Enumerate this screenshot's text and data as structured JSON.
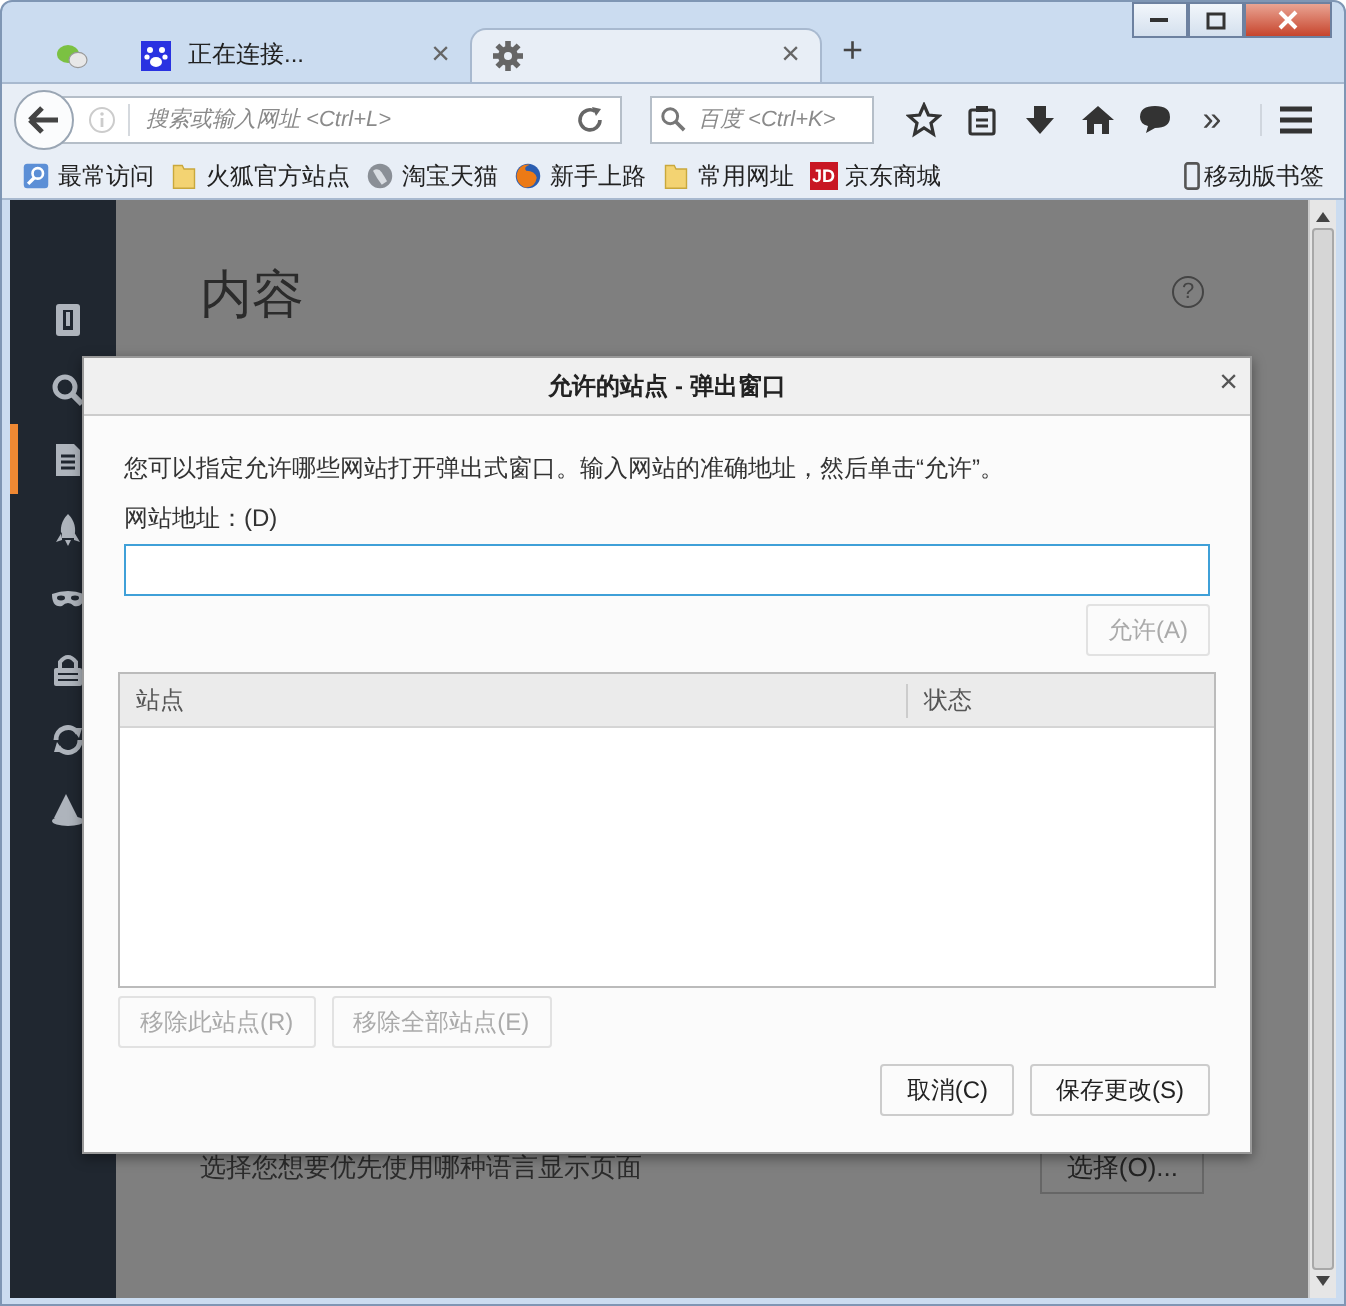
{
  "tabs": [
    {
      "kind": "chat",
      "selected": false
    },
    {
      "kind": "paw",
      "label": "正在连接...",
      "close": "×",
      "selected": false
    },
    {
      "kind": "gear",
      "close": "×",
      "selected": true
    }
  ],
  "new_tab": "+",
  "navbar": {
    "url_placeholder": "搜索或输入网址 <Ctrl+L>",
    "search_placeholder": "百度 <Ctrl+K>",
    "overflow": "»"
  },
  "bookmarks": [
    {
      "kind": "smart",
      "label": "最常访问"
    },
    {
      "kind": "folder",
      "label": "火狐官方站点"
    },
    {
      "kind": "globe",
      "label": "淘宝天猫"
    },
    {
      "kind": "firefox",
      "label": "新手上路"
    },
    {
      "kind": "folder",
      "label": "常用网址"
    },
    {
      "kind": "jd",
      "badge": "JD",
      "label": "京东商城"
    }
  ],
  "mobile_bookmarks": "移动版书签",
  "sidebar": [
    {
      "kind": "general",
      "selected": false
    },
    {
      "kind": "search",
      "selected": false
    },
    {
      "kind": "content",
      "selected": true
    },
    {
      "kind": "apps",
      "selected": false
    },
    {
      "kind": "privacy",
      "selected": false
    },
    {
      "kind": "security",
      "selected": false
    },
    {
      "kind": "sync",
      "selected": false
    },
    {
      "kind": "advanced",
      "selected": false
    }
  ],
  "page": {
    "heading": "内容",
    "help": "?",
    "language_text": "选择您想要优先使用哪种语言显示页面",
    "language_button": "选择(O)..."
  },
  "dialog": {
    "title": "允许的站点 - 弹出窗口",
    "close": "×",
    "description": "您可以指定允许哪些网站打开弹出式窗口。输入网站的准确地址，然后单击“允许”。",
    "address_label": "网站地址：(D)",
    "allow_button": {
      "label": "允许(A)",
      "disabled": true
    },
    "columns": [
      "站点",
      "状态"
    ],
    "remove_buttons": [
      {
        "label": "移除此站点(R)",
        "disabled": true
      },
      {
        "label": "移除全部站点(E)",
        "disabled": true
      }
    ],
    "footer_buttons": [
      "取消(C)",
      "保存更改(S)"
    ]
  }
}
